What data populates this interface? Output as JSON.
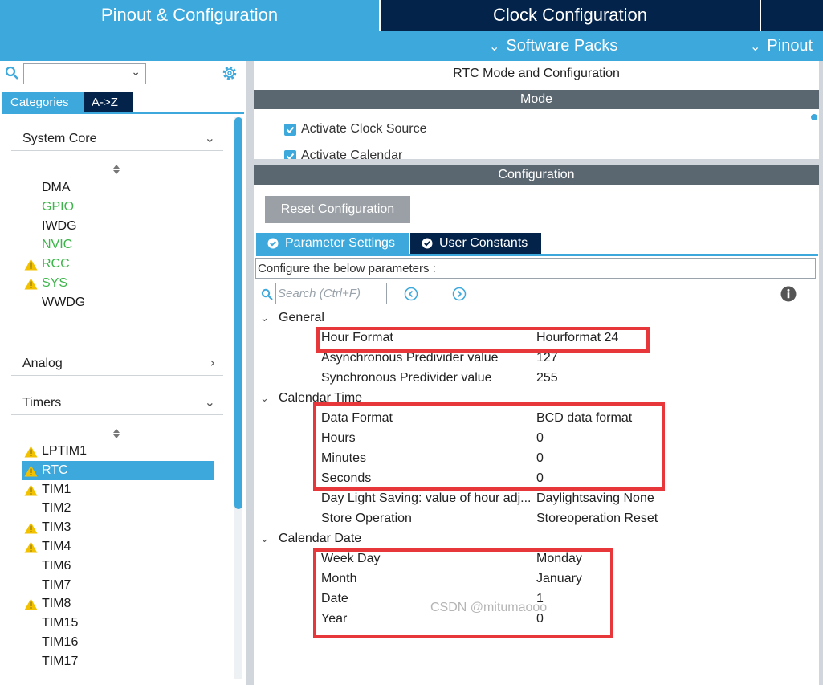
{
  "top_tabs": {
    "pinout": "Pinout & Configuration",
    "clock": "Clock Configuration",
    "extra": ""
  },
  "sub_bar": {
    "software_packs": "Software Packs",
    "pinout": "Pinout"
  },
  "left": {
    "search_value": "",
    "tabs": {
      "categories": "Categories",
      "az": "A->Z"
    },
    "sections": {
      "system_core": "System Core",
      "analog": "Analog",
      "timers": "Timers"
    },
    "system_core_items": [
      {
        "label": "DMA",
        "color": "default",
        "warning": false
      },
      {
        "label": "GPIO",
        "color": "green",
        "warning": false
      },
      {
        "label": "IWDG",
        "color": "default",
        "warning": false
      },
      {
        "label": "NVIC",
        "color": "green",
        "warning": false
      },
      {
        "label": "RCC",
        "color": "green",
        "warning": true
      },
      {
        "label": "SYS",
        "color": "green",
        "warning": true
      },
      {
        "label": "WWDG",
        "color": "default",
        "warning": false
      }
    ],
    "timers_items": [
      {
        "label": "LPTIM1",
        "warning": true,
        "selected": false
      },
      {
        "label": "RTC",
        "warning": true,
        "selected": true
      },
      {
        "label": "TIM1",
        "warning": true,
        "selected": false
      },
      {
        "label": "TIM2",
        "warning": false,
        "selected": false
      },
      {
        "label": "TIM3",
        "warning": true,
        "selected": false
      },
      {
        "label": "TIM4",
        "warning": true,
        "selected": false
      },
      {
        "label": "TIM6",
        "warning": false,
        "selected": false
      },
      {
        "label": "TIM7",
        "warning": false,
        "selected": false
      },
      {
        "label": "TIM8",
        "warning": true,
        "selected": false
      },
      {
        "label": "TIM15",
        "warning": false,
        "selected": false
      },
      {
        "label": "TIM16",
        "warning": false,
        "selected": false
      },
      {
        "label": "TIM17",
        "warning": false,
        "selected": false
      }
    ]
  },
  "right": {
    "title": "RTC Mode and Configuration",
    "mode_bar": "Mode",
    "mode_checks": [
      {
        "label": "Activate Clock Source",
        "checked": true
      },
      {
        "label": "Activate Calendar",
        "checked": true
      }
    ],
    "config_bar": "Configuration",
    "reset_button": "Reset Configuration",
    "param_tabs": {
      "params": "Parameter Settings",
      "users": "User Constants"
    },
    "hint": "Configure the below parameters :",
    "search_placeholder": "Search (Ctrl+F)",
    "groups": {
      "general": {
        "title": "General",
        "rows": [
          {
            "key": "Hour Format",
            "value": "Hourformat 24"
          },
          {
            "key": "Asynchronous Predivider value",
            "value": "127"
          },
          {
            "key": "Synchronous Predivider value",
            "value": "255"
          }
        ]
      },
      "calendar_time": {
        "title": "Calendar Time",
        "rows": [
          {
            "key": "Data Format",
            "value": "BCD data format"
          },
          {
            "key": "Hours",
            "value": "0"
          },
          {
            "key": "Minutes",
            "value": "0"
          },
          {
            "key": "Seconds",
            "value": "0"
          },
          {
            "key": "Day Light Saving: value of hour adj...",
            "value": "Daylightsaving None"
          },
          {
            "key": "Store Operation",
            "value": "Storeoperation Reset"
          }
        ]
      },
      "calendar_date": {
        "title": "Calendar Date",
        "rows": [
          {
            "key": "Week Day",
            "value": "Monday"
          },
          {
            "key": "Month",
            "value": "January"
          },
          {
            "key": "Date",
            "value": "1"
          },
          {
            "key": "Year",
            "value": "0"
          }
        ]
      }
    }
  },
  "watermark": "CSDN @mitumaooo",
  "colors": {
    "accent": "#3ca8dc",
    "dark": "#03234b",
    "bar": "#5b6770",
    "highlight": "#e8373a",
    "green": "#3db54a",
    "warning": "#f2c200"
  }
}
